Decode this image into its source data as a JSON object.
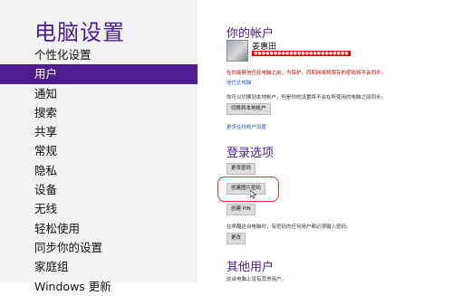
{
  "sidebar": {
    "title": "电脑设置",
    "items": [
      {
        "label": "个性化设置"
      },
      {
        "label": "用户",
        "active": true
      },
      {
        "label": "通知"
      },
      {
        "label": "搜索"
      },
      {
        "label": "共享"
      },
      {
        "label": "常规"
      },
      {
        "label": "隐私"
      },
      {
        "label": "设备"
      },
      {
        "label": "无线"
      },
      {
        "label": "轻松使用"
      },
      {
        "label": "同步你的设置"
      },
      {
        "label": "家庭组"
      },
      {
        "label": "Windows 更新"
      }
    ]
  },
  "account": {
    "heading": "你的帐户",
    "user_name": "姜惠田",
    "email": "●●●●●●●●●●●●●●●●●●●●●●●●",
    "warning": "在你能够信任此电脑之前，为保护，同和网络将保存的密码将不会同步。",
    "trust_link": "信任此电脑",
    "info": "你可以切换到本地帐户，但是你的设置将不会在所使用的电脑之间同步。",
    "switch_button": "切换到本地帐户",
    "more_link": "更多在线帐户设置"
  },
  "login": {
    "heading": "登录选项",
    "change_password": "更改密码",
    "create_picture_password": "创建图片密码",
    "create_pin": "创建 PIN",
    "wake_text": "在唤醒这台电脑时，有密码的任何用户都必须输入密码。",
    "change_button": "更改"
  },
  "other_users": {
    "heading": "其他用户",
    "text": "这台电脑上没有其他用户。"
  },
  "colors": {
    "accent": "#4b1d8f",
    "warning": "#c00000",
    "link": "#2a5bb8",
    "highlight": "#dd3333"
  }
}
